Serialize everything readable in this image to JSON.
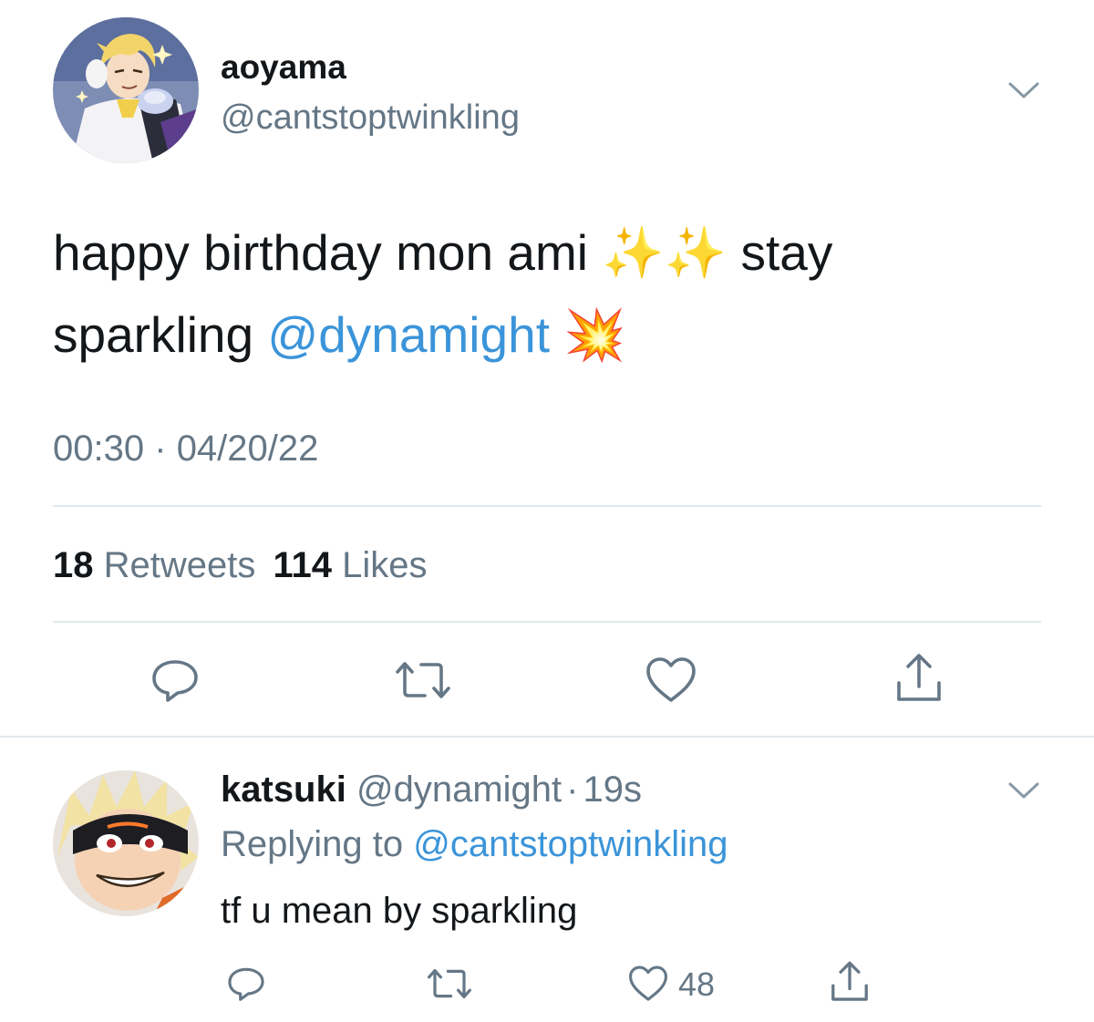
{
  "tweet": {
    "author": {
      "name": "aoyama",
      "handle": "@cantstoptwinkling",
      "avatar": "aoyama-avatar"
    },
    "text_part1": "happy birthday mon ami",
    "emoji_sparkles_1": "✨",
    "emoji_sparkles_2": "✨",
    "text_part2": "stay",
    "text_part3": "sparkling",
    "mention": "@dynamight",
    "emoji_collision": "💥",
    "time": "00:30",
    "separator": "·",
    "date": "04/20/22",
    "stats": {
      "retweets_count": "18",
      "retweets_label": "Retweets",
      "likes_count": "114",
      "likes_label": "Likes"
    },
    "actions": [
      "reply-icon",
      "retweet-icon",
      "heart-icon",
      "share-icon"
    ]
  },
  "reply": {
    "author": {
      "name": "katsuki",
      "handle": "@dynamight",
      "separator": "·",
      "time": "19s",
      "avatar": "katsuki-avatar"
    },
    "replying_to_label": "Replying to",
    "replying_to_handle": "@cantstoptwinkling",
    "text": "tf u mean by sparkling",
    "like_count": "48",
    "actions": [
      "reply-icon",
      "retweet-icon",
      "heart-icon",
      "share-icon"
    ]
  },
  "colors": {
    "text": "#14171a",
    "secondary": "#657786",
    "link": "#3b94d9",
    "divider": "#e1e8ed"
  }
}
